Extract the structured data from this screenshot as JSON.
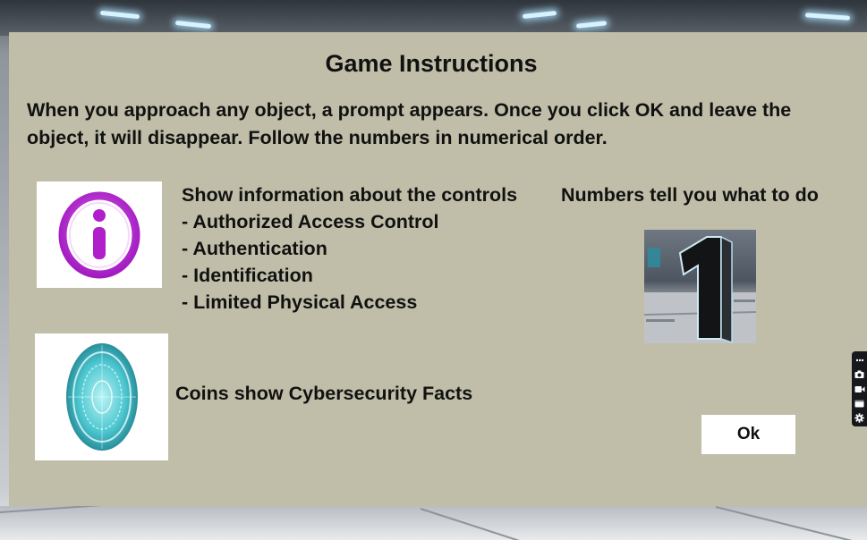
{
  "dialog": {
    "title": "Game Instructions",
    "intro_line1": "When you approach any object, a prompt appears. Once you click OK and leave the",
    "intro_line2": "object, it will disappear. Follow the numbers in numerical order."
  },
  "info_section": {
    "icon": "info-icon",
    "heading": "Show information about the controls",
    "items": [
      "- Authorized Access Control",
      "- Authentication",
      "- Identification",
      "- Limited Physical Access"
    ]
  },
  "numbers_section": {
    "label": "Numbers tell you what to do",
    "icon": "number-one-icon"
  },
  "coins_section": {
    "label": "Coins show Cybersecurity Facts",
    "icon": "coin-icon"
  },
  "ok_button": {
    "label": "Ok"
  },
  "toolbar": {
    "icons": [
      "more-icon",
      "camera-icon",
      "video-icon",
      "window-icon",
      "gear-icon"
    ]
  },
  "colors": {
    "panel": "#c0bea8",
    "info_icon": "#b020c8",
    "coin": "#5fd6dc",
    "button": "#ffffff"
  }
}
